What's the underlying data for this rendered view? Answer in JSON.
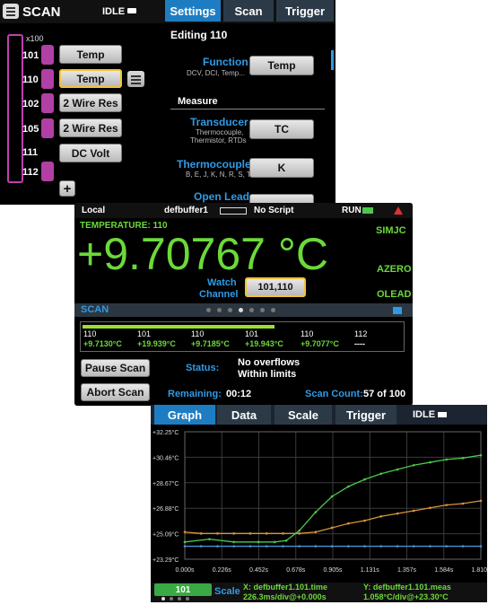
{
  "scan_panel": {
    "title": "SCAN",
    "idle_label": "IDLE",
    "tabs": [
      "Settings",
      "Scan",
      "Trigger"
    ],
    "multiplier": "x100",
    "channels": [
      {
        "num": "101",
        "func": "Temp"
      },
      {
        "num": "110",
        "func": "Temp"
      },
      {
        "num": "102",
        "func": "2 Wire Res"
      },
      {
        "num": "105",
        "func": "2 Wire Res"
      },
      {
        "num": "111",
        "func": "DC Volt"
      },
      {
        "num": "112",
        "func": ""
      }
    ],
    "editing": "Editing 110",
    "function_label": "Function",
    "function_sub": "DCV, DCI, Temp...",
    "function_value": "Temp",
    "measure_header": "Measure",
    "transducer_label": "Transducer",
    "transducer_sub1": "Thermocouple,",
    "transducer_sub2": "Thermistor, RTDs",
    "transducer_value": "TC",
    "thermocouple_label": "Thermocouple",
    "thermocouple_sub": "B, E, J, K, N, R, S, T",
    "thermocouple_value": "K",
    "open_lead_label": "Open Lead"
  },
  "home_panel": {
    "local": "Local",
    "buffer": "defbuffer1",
    "script": "No Script",
    "run": "RUN",
    "temp_label": "TEMPERATURE: 110",
    "reading": "+9.70767 °C",
    "flags": [
      "SIMJC",
      "AZERO",
      "OLEAD"
    ],
    "watch_label1": "Watch",
    "watch_label2": "Channel",
    "watch_value": "101,110",
    "scan_title": "SCAN",
    "progress": 0.6,
    "readings": [
      {
        "ch": "110",
        "val": "+9.7130°C"
      },
      {
        "ch": "101",
        "val": "+19.939°C"
      },
      {
        "ch": "110",
        "val": "+9.7185°C"
      },
      {
        "ch": "101",
        "val": "+19.943°C"
      },
      {
        "ch": "110",
        "val": "+9.7077°C"
      },
      {
        "ch": "112",
        "val": "----"
      }
    ],
    "pause_label": "Pause Scan",
    "abort_label": "Abort Scan",
    "status_label": "Status:",
    "status_line1": "No overflows",
    "status_line2": "Within limits",
    "remaining_label": "Remaining:",
    "remaining_value": "00:12",
    "scan_count_label": "Scan Count:",
    "scan_count_value": "57 of 100"
  },
  "graph_panel": {
    "tabs": [
      "Graph",
      "Data",
      "Scale",
      "Trigger"
    ],
    "idle_label": "IDLE",
    "footer_channel": "101",
    "footer_scale": "Scale",
    "x_info1": "X: defbuffer1.101.time",
    "x_info2": "226.3ms/div@+0.000s",
    "y_info1": "Y: defbuffer1.101.meas",
    "y_info2": "1.058°C/div@+23.30°C",
    "colors": {
      "green": "#4cc94c",
      "orange": "#d9963a",
      "blue": "#4a90d9"
    }
  },
  "chart_data": {
    "type": "line",
    "x_ticks": [
      "0.000s",
      "0.226s",
      "0.452s",
      "0.678s",
      "0.905s",
      "1.131s",
      "1.357s",
      "1.584s",
      "1.810s"
    ],
    "y_ticks": [
      "+32.25°C",
      "+30.46°C",
      "+28.67°C",
      "+26.88°C",
      "+25.09°C",
      "+23.29°C"
    ],
    "xlim": [
      0,
      1.81
    ],
    "ylim": [
      23.29,
      32.25
    ],
    "grid": true,
    "series": [
      {
        "color": "#4cc94c",
        "x": [
          0,
          0.15,
          0.3,
          0.45,
          0.55,
          0.62,
          0.7,
          0.8,
          0.9,
          1.0,
          1.1,
          1.2,
          1.3,
          1.4,
          1.5,
          1.6,
          1.7,
          1.81
        ],
        "y": [
          24.5,
          24.7,
          24.5,
          24.5,
          24.5,
          24.6,
          25.3,
          26.6,
          27.7,
          28.4,
          28.9,
          29.3,
          29.6,
          29.9,
          30.1,
          30.3,
          30.4,
          30.6
        ]
      },
      {
        "color": "#d9963a",
        "x": [
          0,
          0.1,
          0.2,
          0.3,
          0.4,
          0.5,
          0.6,
          0.7,
          0.8,
          0.9,
          1.0,
          1.1,
          1.2,
          1.3,
          1.4,
          1.5,
          1.6,
          1.7,
          1.81
        ],
        "y": [
          25.2,
          25.1,
          25.1,
          25.1,
          25.1,
          25.1,
          25.1,
          25.1,
          25.2,
          25.5,
          25.8,
          26.0,
          26.3,
          26.5,
          26.7,
          26.9,
          27.1,
          27.2,
          27.4
        ]
      },
      {
        "color": "#4a90d9",
        "x": [
          0,
          0.1,
          0.2,
          0.3,
          0.4,
          0.5,
          0.6,
          0.7,
          0.8,
          0.9,
          1.0,
          1.1,
          1.2,
          1.3,
          1.4,
          1.5,
          1.6,
          1.7,
          1.81
        ],
        "y": [
          24.2,
          24.2,
          24.2,
          24.2,
          24.2,
          24.2,
          24.2,
          24.2,
          24.2,
          24.2,
          24.2,
          24.2,
          24.2,
          24.2,
          24.2,
          24.2,
          24.2,
          24.2,
          24.2
        ]
      }
    ]
  }
}
